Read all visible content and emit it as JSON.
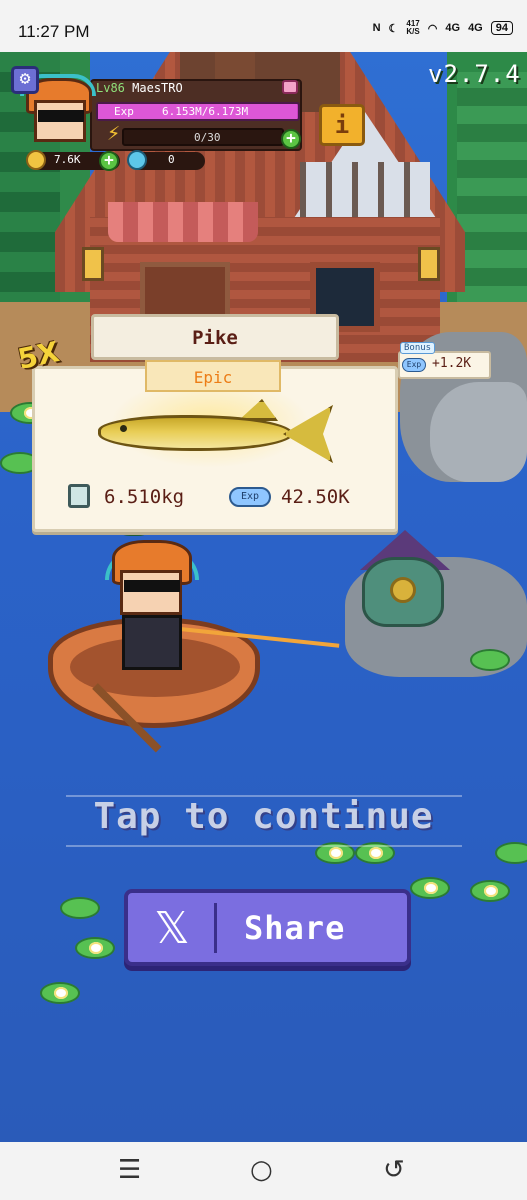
{
  "status_bar": {
    "time": "11:27 PM",
    "net_speed": "417",
    "net_unit": "K/S",
    "signal_1": "4G",
    "signal_2": "4G",
    "battery": "94"
  },
  "hud": {
    "level": "Lv86",
    "player_name": "MaesTRO",
    "exp_label": "Exp",
    "exp_value": "6.153M/6.173M",
    "exp_fraction": 0.997,
    "energy": "0/30",
    "coins": "7.6K",
    "gems": "0",
    "info_label": "i",
    "version": "v2.7.4"
  },
  "catch": {
    "multiplier": "5X",
    "fish_name": "Pike",
    "rarity": "Epic",
    "weight": "6.510kg",
    "exp_badge": "Exp",
    "exp_gain": "42.50K",
    "bonus_label": "Bonus",
    "bonus_exp_badge": "Exp",
    "bonus_value": "+1.2K"
  },
  "prompt": {
    "tap_to_continue": "Tap to continue",
    "share_label": "Share"
  },
  "colors": {
    "water": "#2f6fd3",
    "rarity_epic": "#ec7d17",
    "share_button": "#7b6ee0",
    "exp_bar": "#c53fbf"
  },
  "icons": {
    "settings": "gear-icon",
    "energy": "lightning-icon",
    "coins": "coin-icon",
    "gems": "gem-icon",
    "share": "x-logo-icon",
    "nav_recents": "recents-icon",
    "nav_home": "home-icon",
    "nav_back": "back-icon"
  }
}
